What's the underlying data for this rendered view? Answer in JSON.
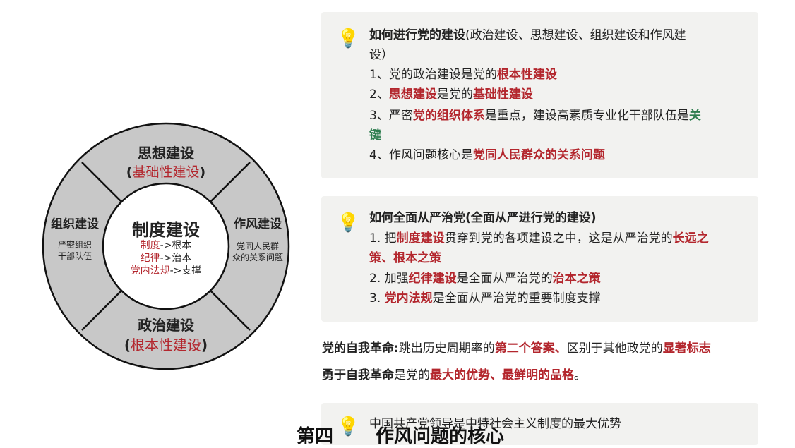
{
  "diagram": {
    "center": {
      "title": "制度建设",
      "l1a": "制度",
      "l1b": "->根本",
      "l2a": "纪律",
      "l2b": "->治本",
      "l3a": "党内法规",
      "l3b": "->支撑"
    },
    "top": {
      "title": "思想建设",
      "open": "(",
      "sub": "基础性建设",
      "close": ")"
    },
    "bottom": {
      "title": "政治建设",
      "open": "(",
      "sub": "根本性建设",
      "close": ")"
    },
    "left": {
      "title": "组织建设",
      "sub1": "严密组织",
      "sub2": "干部队伍"
    },
    "right": {
      "title": "作风建设",
      "sub1": "党同人民群",
      "sub2": "众的关系问题"
    },
    "colors": {
      "ring": "#c8c8c8",
      "stroke": "#111111",
      "center": "#ffffff",
      "accent": "#b3262d"
    }
  },
  "card1": {
    "icon": "lightbulb-icon",
    "title_b": "如何进行党的建设",
    "title_n": "(政治建设、思想建设、组织建设和作风建",
    "title_n2": "设）",
    "i1a": "1、党的政治建设是党的",
    "i1b": "根本性建设",
    "i2a": "2、",
    "i2b": "思想建设",
    "i2c": "是党的",
    "i2d": "基础性建设",
    "i3a": "3、严密",
    "i3b": "党的组织体系",
    "i3c": "是重点，建设高素质专业化干部队伍是",
    "i3d": "关",
    "i3e": "键",
    "i4a": "4、作风问题核心是",
    "i4b": "党同人民群众的关系问题"
  },
  "card2": {
    "icon": "lightbulb-icon",
    "title": "如何全面从严治党(全面从严进行党的建设)",
    "i1a": "1. 把",
    "i1b": "制度建设",
    "i1c": "贯穿到党的各项建设之中，这是从严治党的",
    "i1d": "长远之",
    "i1e": "策、根本之策",
    "i2a": "2. 加强",
    "i2b": "纪律建设",
    "i2c": "是全面从严治党的",
    "i2d": "治本之策",
    "i3a": "3. ",
    "i3b": "党内法规",
    "i3c": "是全面从严治党的重要制度支撑"
  },
  "revolution": {
    "l1a": "党的自我革命:",
    "l1b": "跳出历史周期率的",
    "l1c": "第二个答案、",
    "l1d": "区别于其他政党的",
    "l1e": "显著标志",
    "l2a": "勇于自我革命",
    "l2b": "是党的",
    "l2c": "最大的优势、最鲜明的品格",
    "l2d": "。"
  },
  "card3": {
    "icon": "lightbulb-icon",
    "text": "中国共产党领导是中特社会主义制度的最大优势"
  },
  "overlay": {
    "a": "第四",
    "b": "作风问题的核心"
  }
}
